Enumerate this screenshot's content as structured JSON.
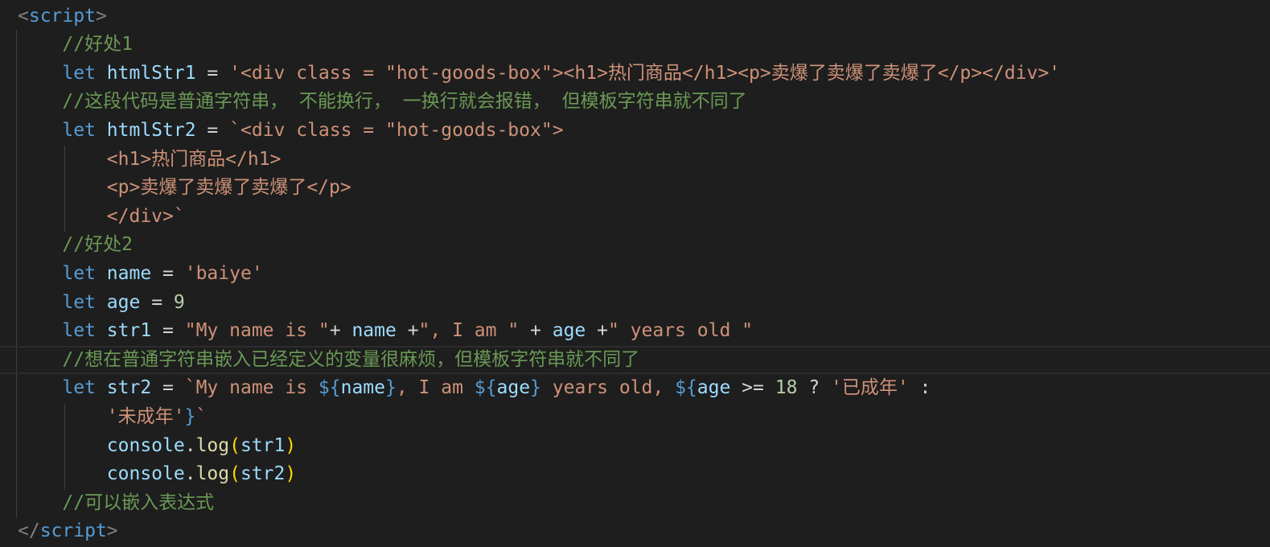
{
  "editor": {
    "lines": [
      [
        {
          "t": "<",
          "c": "tag"
        },
        {
          "t": "script",
          "c": "tagname"
        },
        {
          "t": ">",
          "c": "tag"
        }
      ],
      [
        {
          "t": "    "
        },
        {
          "t": "//好处1",
          "c": "cmt"
        }
      ],
      [
        {
          "t": "    "
        },
        {
          "t": "let",
          "c": "kw"
        },
        {
          "t": " "
        },
        {
          "t": "htmlStr1",
          "c": "var"
        },
        {
          "t": " = ",
          "c": "op"
        },
        {
          "t": "'<div class = \"hot-goods-box\"><h1>热门商品</h1><p>卖爆了卖爆了卖爆了</p></div>'",
          "c": "str"
        }
      ],
      [
        {
          "t": "    "
        },
        {
          "t": "//这段代码是普通字符串， 不能换行， 一换行就会报错， 但模板字符串就不同了",
          "c": "cmt"
        }
      ],
      [
        {
          "t": "    "
        },
        {
          "t": "let",
          "c": "kw"
        },
        {
          "t": " "
        },
        {
          "t": "htmlStr2",
          "c": "var"
        },
        {
          "t": " = ",
          "c": "op"
        },
        {
          "t": "`<div class = \"hot-goods-box\">",
          "c": "str"
        }
      ],
      [
        {
          "t": "        "
        },
        {
          "t": "<h1>热门商品</h1>",
          "c": "str"
        }
      ],
      [
        {
          "t": "        "
        },
        {
          "t": "<p>卖爆了卖爆了卖爆了</p>",
          "c": "str"
        }
      ],
      [
        {
          "t": "        "
        },
        {
          "t": "</div>`",
          "c": "str"
        }
      ],
      [
        {
          "t": "    "
        },
        {
          "t": "//好处2",
          "c": "cmt"
        }
      ],
      [
        {
          "t": "    "
        },
        {
          "t": "let",
          "c": "kw"
        },
        {
          "t": " "
        },
        {
          "t": "name",
          "c": "var"
        },
        {
          "t": " = ",
          "c": "op"
        },
        {
          "t": "'baiye'",
          "c": "str"
        }
      ],
      [
        {
          "t": "    "
        },
        {
          "t": "let",
          "c": "kw"
        },
        {
          "t": " "
        },
        {
          "t": "age",
          "c": "var"
        },
        {
          "t": " = ",
          "c": "op"
        },
        {
          "t": "9",
          "c": "num"
        }
      ],
      [
        {
          "t": "    "
        },
        {
          "t": "let",
          "c": "kw"
        },
        {
          "t": " "
        },
        {
          "t": "str1",
          "c": "var"
        },
        {
          "t": " = ",
          "c": "op"
        },
        {
          "t": "\"My name is \"",
          "c": "str"
        },
        {
          "t": "+ ",
          "c": "op"
        },
        {
          "t": "name",
          "c": "var"
        },
        {
          "t": " +",
          "c": "op"
        },
        {
          "t": "\", I am \"",
          "c": "str"
        },
        {
          "t": " + ",
          "c": "op"
        },
        {
          "t": "age",
          "c": "var"
        },
        {
          "t": " +",
          "c": "op"
        },
        {
          "t": "\" years old \"",
          "c": "str"
        }
      ],
      [
        {
          "t": "    "
        },
        {
          "t": "//想在普通字符串嵌入已经定义的变量很麻烦，但模板字符串就不同了",
          "c": "cmt"
        }
      ],
      [
        {
          "t": "    "
        },
        {
          "t": "let",
          "c": "kw"
        },
        {
          "t": " "
        },
        {
          "t": "str2",
          "c": "var"
        },
        {
          "t": " = ",
          "c": "op"
        },
        {
          "t": "`My name is ",
          "c": "str"
        },
        {
          "t": "${",
          "c": "tpl"
        },
        {
          "t": "name",
          "c": "var"
        },
        {
          "t": "}",
          "c": "tpl"
        },
        {
          "t": ", I am ",
          "c": "str"
        },
        {
          "t": "${",
          "c": "tpl"
        },
        {
          "t": "age",
          "c": "var"
        },
        {
          "t": "}",
          "c": "tpl"
        },
        {
          "t": " years old, ",
          "c": "str"
        },
        {
          "t": "${",
          "c": "tpl"
        },
        {
          "t": "age",
          "c": "var"
        },
        {
          "t": " >= ",
          "c": "op"
        },
        {
          "t": "18",
          "c": "num"
        },
        {
          "t": " ? ",
          "c": "op"
        },
        {
          "t": "'已成年'",
          "c": "str"
        },
        {
          "t": " :",
          "c": "op"
        }
      ],
      [
        {
          "t": "        "
        },
        {
          "t": "'未成年'",
          "c": "str"
        },
        {
          "t": "}",
          "c": "tpl"
        },
        {
          "t": "`",
          "c": "str"
        }
      ],
      [
        {
          "t": "        "
        },
        {
          "t": "console",
          "c": "var"
        },
        {
          "t": ".",
          "c": "op"
        },
        {
          "t": "log",
          "c": "fn"
        },
        {
          "t": "(",
          "c": "paren"
        },
        {
          "t": "str1",
          "c": "var"
        },
        {
          "t": ")",
          "c": "paren"
        }
      ],
      [
        {
          "t": "        "
        },
        {
          "t": "console",
          "c": "var"
        },
        {
          "t": ".",
          "c": "op"
        },
        {
          "t": "log",
          "c": "fn"
        },
        {
          "t": "(",
          "c": "paren"
        },
        {
          "t": "str2",
          "c": "var"
        },
        {
          "t": ")",
          "c": "paren"
        }
      ],
      [
        {
          "t": "    "
        },
        {
          "t": "//可以嵌入表达式",
          "c": "cmt"
        }
      ],
      [
        {
          "t": "</",
          "c": "tag"
        },
        {
          "t": "script",
          "c": "tagname"
        },
        {
          "t": ">",
          "c": "tag"
        }
      ]
    ],
    "current_line": 12
  },
  "colors": {
    "background": "#1e1e1e",
    "keyword": "#569cd6",
    "variable": "#9cdcfe",
    "string": "#ce9178",
    "number": "#b5cea8",
    "comment": "#6a9955",
    "function": "#dcdcaa",
    "bracket": "#ffd700",
    "tag_bracket": "#808080"
  }
}
